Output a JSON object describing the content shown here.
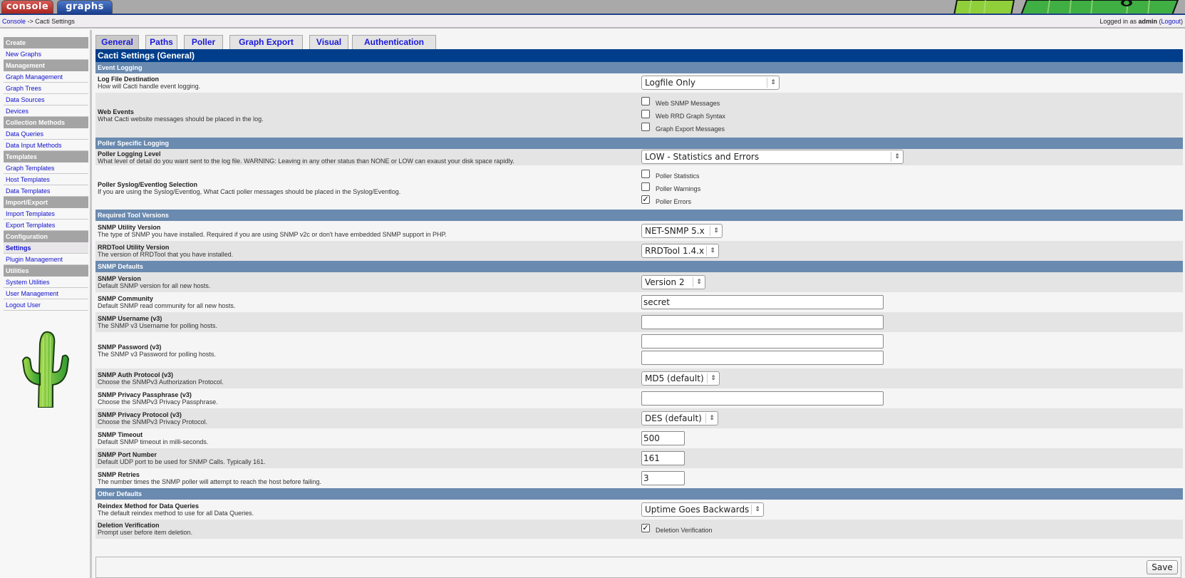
{
  "topbar": {
    "tabs": [
      {
        "label": "console",
        "active": true
      },
      {
        "label": "graphs",
        "active": false
      }
    ]
  },
  "breadcrumb": {
    "root": "Console",
    "separator": " -> ",
    "current": "Cacti Settings"
  },
  "session": {
    "prefix": "Logged in as ",
    "user": "admin",
    "logout_open": " (",
    "logout": "Logout",
    "logout_close": ")"
  },
  "sidebar": {
    "sections": [
      {
        "header": "Create",
        "items": [
          "New Graphs"
        ]
      },
      {
        "header": "Management",
        "items": [
          "Graph Management",
          "Graph Trees",
          "Data Sources",
          "Devices"
        ]
      },
      {
        "header": "Collection Methods",
        "items": [
          "Data Queries",
          "Data Input Methods"
        ]
      },
      {
        "header": "Templates",
        "items": [
          "Graph Templates",
          "Host Templates",
          "Data Templates"
        ]
      },
      {
        "header": "Import/Export",
        "items": [
          "Import Templates",
          "Export Templates"
        ]
      },
      {
        "header": "Configuration",
        "items": [
          "Settings",
          "Plugin Management"
        ]
      },
      {
        "header": "Utilities",
        "items": [
          "System Utilities",
          "User Management",
          "Logout User"
        ]
      }
    ],
    "active_item": "Settings"
  },
  "tabs": [
    {
      "label": "General",
      "active": true
    },
    {
      "label": "Paths",
      "active": false
    },
    {
      "label": "Poller",
      "active": false
    },
    {
      "label": "Graph Export",
      "active": false
    },
    {
      "label": "Visual",
      "active": false
    },
    {
      "label": "Authentication",
      "active": false
    }
  ],
  "panel": {
    "title": "Cacti Settings (General)",
    "sections": {
      "event_logging": "Event Logging",
      "poller_logging": "Poller Specific Logging",
      "tool_versions": "Required Tool Versions",
      "snmp_defaults": "SNMP Defaults",
      "other_defaults": "Other Defaults"
    },
    "fields": {
      "log_destination": {
        "title": "Log File Destination",
        "desc": "How will Cacti handle event logging.",
        "value": "Logfile Only"
      },
      "web_events": {
        "title": "Web Events",
        "desc": "What Cacti website messages should be placed in the log.",
        "options": [
          {
            "label": "Web SNMP Messages",
            "checked": false
          },
          {
            "label": "Web RRD Graph Syntax",
            "checked": false
          },
          {
            "label": "Graph Export Messages",
            "checked": false
          }
        ]
      },
      "poller_level": {
        "title": "Poller Logging Level",
        "desc": "What level of detail do you want sent to the log file. WARNING: Leaving in any other status than NONE or LOW can exaust your disk space rapidly.",
        "value": "LOW - Statistics and Errors"
      },
      "poller_syslog": {
        "title": "Poller Syslog/Eventlog Selection",
        "desc": "If you are using the Syslog/Eventlog, What Cacti poller messages should be placed in the Syslog/Eventlog.",
        "options": [
          {
            "label": "Poller Statistics",
            "checked": false
          },
          {
            "label": "Poller Warnings",
            "checked": false
          },
          {
            "label": "Poller Errors",
            "checked": true
          }
        ]
      },
      "snmp_utility": {
        "title": "SNMP Utility Version",
        "desc": "The type of SNMP you have installed. Required if you are using SNMP v2c or don't have embedded SNMP support in PHP.",
        "value": "NET-SNMP 5.x"
      },
      "rrdtool_version": {
        "title": "RRDTool Utility Version",
        "desc": "The version of RRDTool that you have installed.",
        "value": "RRDTool 1.4.x"
      },
      "snmp_version": {
        "title": "SNMP Version",
        "desc": "Default SNMP version for all new hosts.",
        "value": "Version 2"
      },
      "snmp_community": {
        "title": "SNMP Community",
        "desc": "Default SNMP read community for all new hosts.",
        "value": "secret"
      },
      "snmp_username": {
        "title": "SNMP Username (v3)",
        "desc": "The SNMP v3 Username for polling hosts.",
        "value": ""
      },
      "snmp_password": {
        "title": "SNMP Password (v3)",
        "desc": "The SNMP v3 Password for polling hosts.",
        "value": "",
        "confirm": ""
      },
      "snmp_auth": {
        "title": "SNMP Auth Protocol (v3)",
        "desc": "Choose the SNMPv3 Authorization Protocol.",
        "value": "MD5 (default)"
      },
      "snmp_priv_pass": {
        "title": "SNMP Privacy Passphrase (v3)",
        "desc": "Choose the SNMPv3 Privacy Passphrase.",
        "value": ""
      },
      "snmp_priv_proto": {
        "title": "SNMP Privacy Protocol (v3)",
        "desc": "Choose the SNMPv3 Privacy Protocol.",
        "value": "DES (default)"
      },
      "snmp_timeout": {
        "title": "SNMP Timeout",
        "desc": "Default SNMP timeout in milli-seconds.",
        "value": "500"
      },
      "snmp_port": {
        "title": "SNMP Port Number",
        "desc": "Default UDP port to be used for SNMP Calls. Typically 161.",
        "value": "161"
      },
      "snmp_retries": {
        "title": "SNMP Retries",
        "desc": "The number times the SNMP poller will attempt to reach the host before failing.",
        "value": "3"
      },
      "reindex_method": {
        "title": "Reindex Method for Data Queries",
        "desc": "The default reindex method to use for all Data Queries.",
        "value": "Uptime Goes Backwards"
      },
      "deletion_verification": {
        "title": "Deletion Verification",
        "desc": "Prompt user before item deletion.",
        "option_label": "Deletion Verification",
        "checked": true
      }
    }
  },
  "actions": {
    "save_label": "Save"
  },
  "icons": {
    "select_arrow": "⇕",
    "check": "✓"
  }
}
